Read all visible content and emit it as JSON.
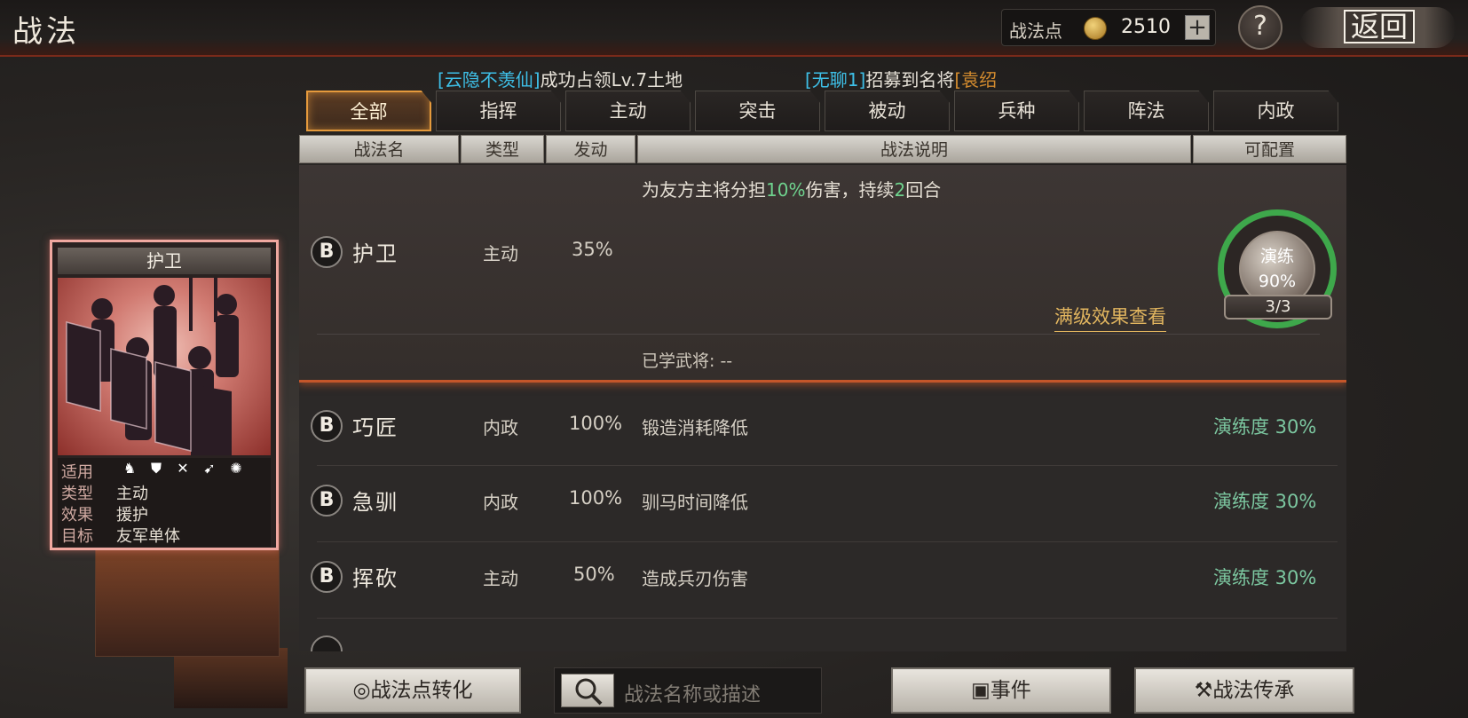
{
  "header": {
    "title": "战法",
    "points_label": "战法点",
    "points_value": "2510",
    "plus": "+",
    "help": "?",
    "back": "返回"
  },
  "ticker": {
    "name1": "[云隐不羡仙]",
    "text1": "成功占领Lv.7土地",
    "name2": "[无聊1]",
    "text2": "招募到名将",
    "name3": "[袁绍"
  },
  "tabs": [
    "全部",
    "指挥",
    "主动",
    "突击",
    "被动",
    "兵种",
    "阵法",
    "内政"
  ],
  "columns": {
    "name": "战法名",
    "type": "类型",
    "trigger": "发动",
    "desc": "战法说明",
    "configurable": "可配置"
  },
  "expanded": {
    "grade": "B",
    "name": "护卫",
    "type": "主动",
    "rate": "35%",
    "desc_pre": "为友方主将分担",
    "desc_hl1": "10%",
    "desc_mid": "伤害，持续",
    "desc_hl2": "2",
    "desc_post": "回合",
    "max_link": "满级效果查看",
    "learned": "已学武将:  --",
    "practice_label": "演练",
    "practice_value": "90%",
    "practice_count": "3/3"
  },
  "rows": [
    {
      "grade": "B",
      "name": "巧匠",
      "type": "内政",
      "rate": "100%",
      "desc": "锻造消耗降低",
      "progress": "演练度 30%"
    },
    {
      "grade": "B",
      "name": "急驯",
      "type": "内政",
      "rate": "100%",
      "desc": "驯马时间降低",
      "progress": "演练度 30%"
    },
    {
      "grade": "B",
      "name": "挥砍",
      "type": "主动",
      "rate": "50%",
      "desc": "造成兵刃伤害",
      "progress": "演练度 30%"
    }
  ],
  "card": {
    "title": "护卫",
    "use_label": "适用",
    "type_label": "类型",
    "type_value": "主动",
    "effect_label": "效果",
    "effect_value": "援护",
    "target_label": "目标",
    "target_value": "友军单体"
  },
  "bottom": {
    "convert": "战法点转化",
    "search_placeholder": "战法名称或描述",
    "events": "事件",
    "inherit": "战法传承"
  }
}
